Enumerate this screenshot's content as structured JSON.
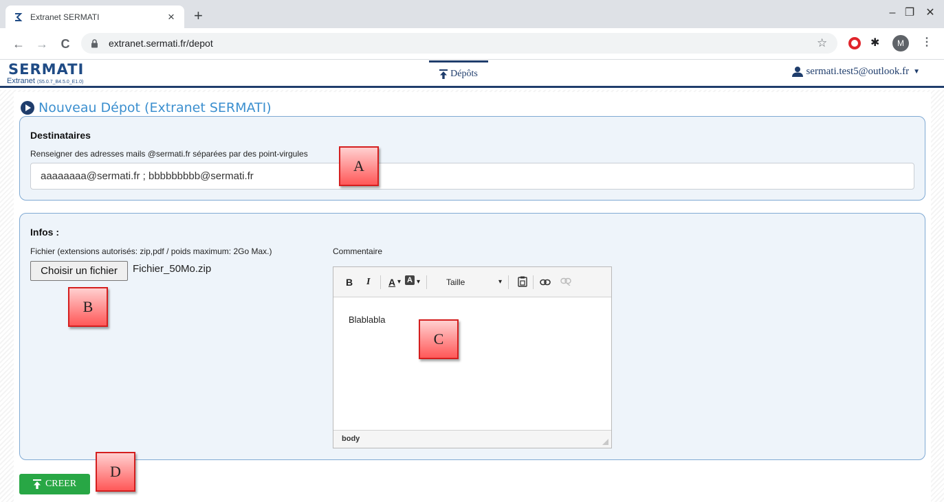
{
  "browser": {
    "tab_title": "Extranet SERMATI",
    "tab_close": "×",
    "new_tab": "+",
    "url": "extranet.sermati.fr/depot",
    "avatar_letter": "M",
    "window_controls": {
      "minimize": "–",
      "maximize": "❐",
      "close": "✕"
    },
    "nav": {
      "back": "←",
      "forward": "→",
      "reload": "C"
    },
    "bookmark": "☆",
    "menu": "⋮"
  },
  "site": {
    "logo_text": "SERMATI",
    "subline": "Extranet",
    "version": "(S5.0.7_B4.5.0_E1.0)",
    "nav_label": "Dépôts",
    "user_email": "sermati.test5@outlook.fr",
    "user_caret": "▼"
  },
  "page": {
    "title": "Nouveau Dépot (Extranet SERMATI)"
  },
  "destinataires": {
    "title": "Destinataires",
    "help": "Renseigner des adresses mails @sermati.fr séparées par des point-virgules",
    "value": "aaaaaaaa@sermati.fr ; bbbbbbbbb@sermati.fr"
  },
  "infos": {
    "title": "Infos :",
    "file_label": "Fichier (extensions autorisés: zip,pdf / poids maximum: 2Go Max.)",
    "file_button": "Choisir un fichier",
    "file_name": "Fichier_50Mo.zip",
    "comment_label": "Commentaire",
    "editor": {
      "bold": "B",
      "italic": "I",
      "font_color": "A",
      "bg_color": "A",
      "dropdown_arrow": "▾",
      "size_label": "Taille",
      "content": "Blablabla",
      "status_path": "body"
    }
  },
  "actions": {
    "create_label": "CREER"
  },
  "callouts": [
    "A",
    "B",
    "C",
    "D"
  ],
  "colors": {
    "brand_blue": "#1f3d6c",
    "title_blue": "#3b8fcf",
    "panel_bg": "#eef4fa",
    "panel_border": "#7fa9d3",
    "create_green": "#28a745",
    "callout_red": "#ff5858"
  }
}
